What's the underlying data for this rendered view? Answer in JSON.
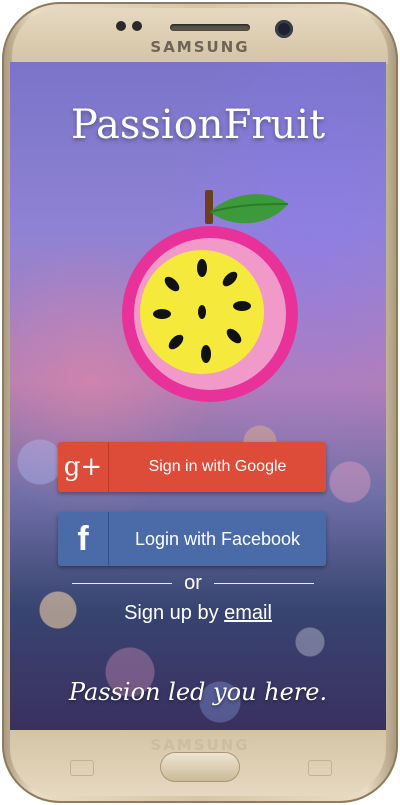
{
  "device": {
    "brand_top": "SAMSUNG",
    "brand_bottom": "SAMSUNG"
  },
  "app": {
    "title": "PassionFruit",
    "tagline": "Passion led you here."
  },
  "auth": {
    "google": {
      "icon": "google-plus-icon",
      "icon_glyph": "g+",
      "label": "Sign in with Google"
    },
    "facebook": {
      "icon": "facebook-icon",
      "icon_glyph": "f",
      "label": "Login with Facebook"
    },
    "divider_text": "or",
    "signup_prefix": "Sign up by",
    "signup_link": "email"
  },
  "colors": {
    "google_red": "#dd4b39",
    "facebook_blue": "#4a6aa8",
    "fruit_magenta": "#e8329a",
    "fruit_pink": "#f19ac9",
    "fruit_yellow": "#f5ea3c",
    "leaf_green": "#3d9a3a"
  }
}
